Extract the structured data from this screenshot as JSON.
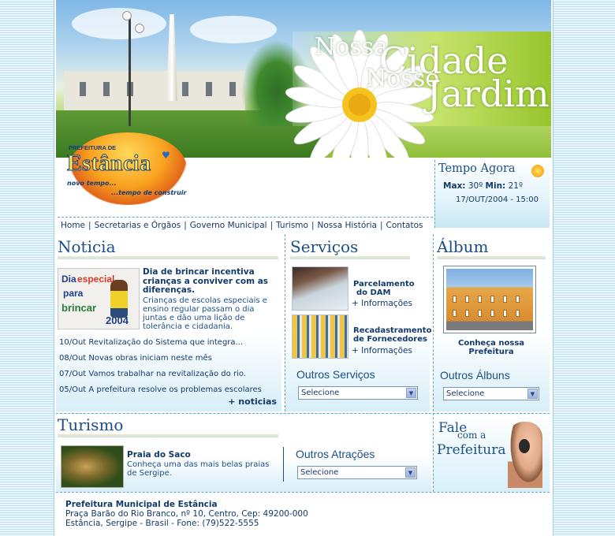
{
  "banner": {
    "slogan_nossa1": "Nossa",
    "slogan_cidade": "Cidade",
    "slogan_nossa2": "Nosso",
    "slogan_jardim": "Jardim"
  },
  "logo": {
    "prefix": "PREFEITURA DE",
    "name": "Estância",
    "tagline_1": "novo tempo...",
    "tagline_2": "...tempo de construir"
  },
  "weather": {
    "title": "Tempo Agora",
    "max_label": "Max:",
    "max_value": "30º",
    "min_label": "Min:",
    "min_value": "21º",
    "datetime": "17/OUT/2004 - 15:00",
    "icon": "sun-icon"
  },
  "nav": [
    "Home",
    "Secretarias e Órgãos",
    "Governo Municipal",
    "Turismo",
    "Nossa História",
    "Contatos"
  ],
  "noticia": {
    "title": "Noticia",
    "thumb_text": [
      "Dia",
      "especial",
      "para",
      "brincar",
      "2004"
    ],
    "headline": "Dia de brincar incentiva crianças a conviver com as diferenças.",
    "lead": "Crianças de escolas especiais e ensino regular passam o dia juntas e dão uma lição de tolerância e cidadania.",
    "items": [
      "10/Out Revitalização do Sistema que integra...",
      "08/Out Novas obras iniciam neste mês",
      "07/Out Vamos trabalhar na revitalização do rio.",
      "05/Out A prefeitura resolve os problemas escolares"
    ],
    "more": "+ noticias"
  },
  "servicos": {
    "title": "Serviços",
    "items": [
      {
        "label_1": "Parcelamento",
        "label_2": "do DAM",
        "info": "+ Informações"
      },
      {
        "label_1": "Recadastramento",
        "label_2": "de Fornecedores",
        "info": "+ Informações"
      }
    ],
    "outros_title": "Outros Serviços",
    "select_value": "Selecione"
  },
  "album": {
    "title": "Álbum",
    "caption_1": "Conheça nossa",
    "caption_2": "Prefeitura",
    "outros_title": "Outros Álbuns",
    "select_value": "Selecione"
  },
  "turismo": {
    "title": "Turismo",
    "place": "Praia do Saco",
    "desc": "Conheça uma das mais belas praias de Sergipe.",
    "outros_title": "Outros Atrações",
    "select_value": "Selecione"
  },
  "fale": {
    "w1": "Fale",
    "w2": "com a",
    "w3": "Prefeitura"
  },
  "footer": {
    "name": "Prefeitura Municipal de Estância",
    "address": "Praça Barão do Rio Branco, nº 10, Centro, Cep: 49200-000",
    "city_phone": "Estância, Sergipe - Brasil - Fone: (79)522-5555"
  },
  "colors": {
    "brand_blue": "#1b4f86",
    "text_dark": "#123a6b",
    "accent_gold": "#efe6bf",
    "divider": "#5aa8c8"
  }
}
